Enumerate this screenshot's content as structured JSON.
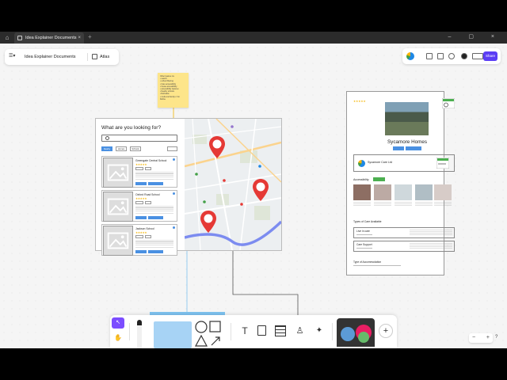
{
  "browser": {
    "tab_title": "Idea Explainer Documents",
    "tab_close": "×",
    "new_tab": "+",
    "home": "⌂",
    "window_controls": "– ▢ ×"
  },
  "doc_toolbar": {
    "menu_icon": "☰▾",
    "title": "Idea Explainer Documents",
    "atlas_label": "Atlas"
  },
  "top_right": {
    "share_label": "Share"
  },
  "sticky_note": {
    "lines": [
      "Other feature ins",
      "• search",
      "• school filtering",
      "• Care accessibility",
      "• house accessibility",
      "• accessibility features",
      "• Nearby schools",
      "• Refinable",
      "• multi-cost family x 3 in",
      "  Refine"
    ]
  },
  "search_panel": {
    "title": "What are you looking for?",
    "filters": [
      "Nearby",
      "Homes",
      "Schools"
    ],
    "schools": [
      {
        "name": "Greengate Central School",
        "stars": "★★★★★"
      },
      {
        "name": "Oxford Road School",
        "stars": "★★★★★"
      },
      {
        "name": "Jackson School",
        "stars": "★★★★★"
      }
    ]
  },
  "property": {
    "stars": "★★★★★",
    "name": "Sycamore Homes",
    "company": "Sycamore Care Ltd",
    "accessibility_label": "Accessibility",
    "types_of_care_label": "Types of Care Available",
    "care_types": [
      "Live in care",
      "Care Support"
    ],
    "types_accom_label": "Type of Accommodation"
  },
  "toolbar": {
    "select_icon": "↖",
    "hand_icon": "✋",
    "text_icon": "T",
    "stamp_icon": "♙",
    "ai_icon": "✦",
    "plus_icon": "+"
  },
  "zoom": {
    "out": "−",
    "in": "+",
    "help": "?"
  },
  "colors": {
    "accent": "#7c4dff",
    "button_blue": "#4a90e2",
    "sticky_yellow": "#fde58a",
    "pin_red": "#e53935"
  }
}
